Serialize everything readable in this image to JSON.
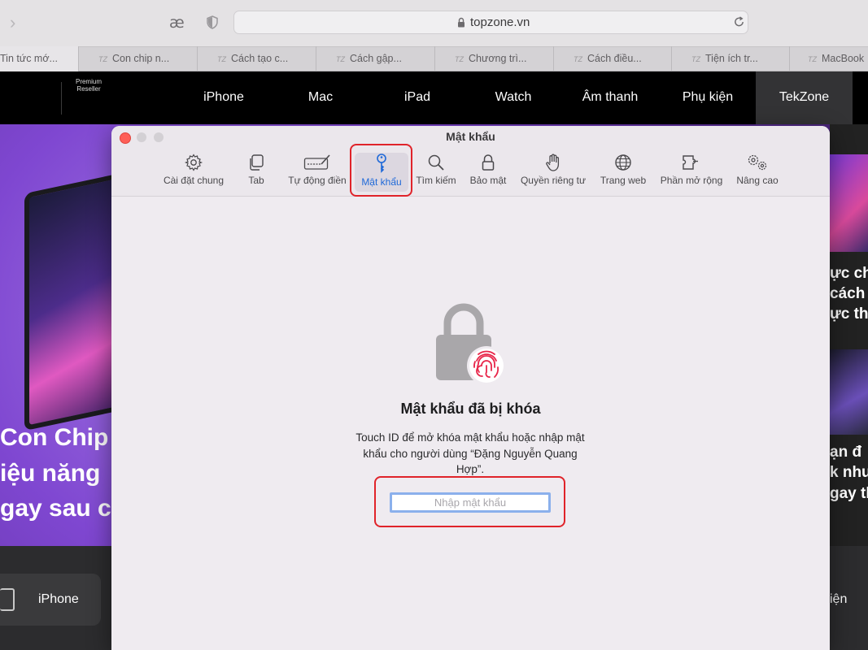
{
  "browser": {
    "url": "topzone.vn",
    "ae_label": "æ",
    "tabs": [
      {
        "label": "Tin tức mớ..."
      },
      {
        "label": "Con chip n..."
      },
      {
        "label": "Cách tạo c..."
      },
      {
        "label": "Cách gập..."
      },
      {
        "label": "Chương trì..."
      },
      {
        "label": "Cách điều..."
      },
      {
        "label": "Tiện ích tr..."
      },
      {
        "label": "MacBook"
      }
    ]
  },
  "site": {
    "brand_line1": "Premium",
    "brand_line2": "Reseller",
    "nav": [
      "iPhone",
      "Mac",
      "iPad",
      "Watch",
      "Âm thanh",
      "Phụ kiện",
      "TekZone"
    ],
    "hero_lines": [
      "Con Chip r",
      "iệu năng",
      "gay sau c"
    ],
    "right_lines": [
      "ực ch",
      "cách",
      "ực thự",
      "ạn đ",
      "k như",
      "gay th"
    ],
    "category_left": "iPhone",
    "category_right": "iện"
  },
  "prefs": {
    "title": "Mật khẩu",
    "tabs": [
      "Cài đặt chung",
      "Tab",
      "Tự động điền",
      "Mật khẩu",
      "Tìm kiếm",
      "Bảo mật",
      "Quyền riêng tư",
      "Trang web",
      "Phần mở rộng",
      "Nâng cao"
    ],
    "active_tab": "Mật khẩu",
    "locked_title": "Mật khẩu đã bị khóa",
    "locked_message": "Touch ID để mở khóa mật khẩu hoặc nhập mật khẩu cho người dùng “Đặng Nguyễn Quang Hợp”.",
    "password_placeholder": "Nhập mật khẩu",
    "highlight_color": "#e0232a",
    "accent_color": "#1f69d8"
  }
}
